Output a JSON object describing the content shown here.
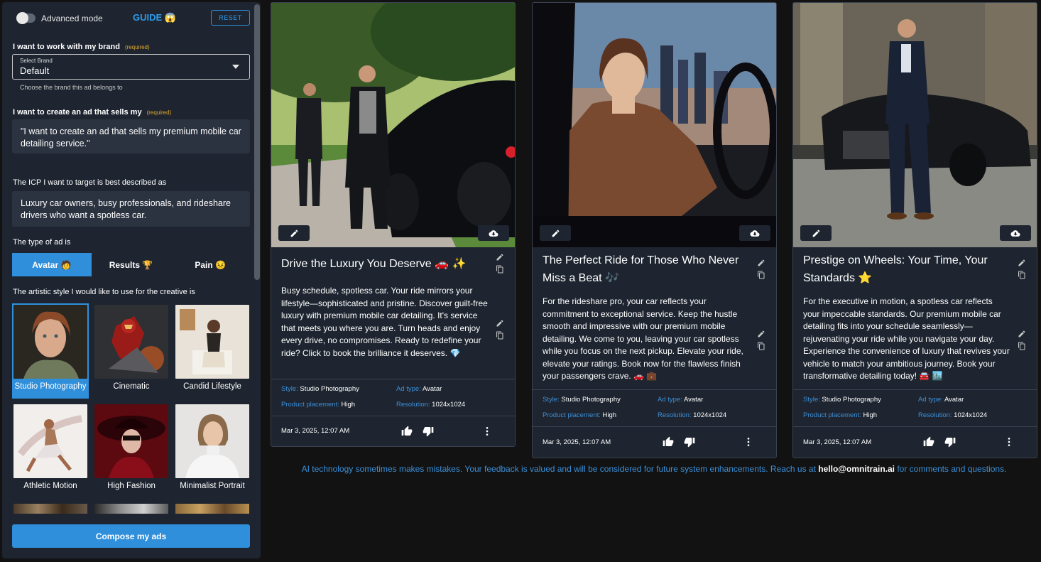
{
  "header": {
    "advanced_mode": "Advanced mode",
    "guide": "GUIDE",
    "guide_emoji": "😱",
    "reset": "RESET"
  },
  "brand": {
    "label": "I want to work with my brand",
    "required": "(required)",
    "select_legend": "Select Brand",
    "value": "Default",
    "helper": "Choose the brand this ad belongs to"
  },
  "product": {
    "label": "I want to create an ad that sells my",
    "required": "(required)",
    "value": "\"I want to create an ad that sells my premium mobile car detailing service.\""
  },
  "icp": {
    "label": "The ICP I want to target is best described as",
    "value": "Luxury car owners, busy professionals, and rideshare drivers who want a spotless car."
  },
  "ad_type": {
    "label": "The type of ad is",
    "tabs": [
      "Avatar 🧑",
      "Results 🏆",
      "Pain 😣"
    ],
    "active": 0
  },
  "style": {
    "label": "The artistic style I would like to use for the creative is",
    "options": [
      "Studio Photography",
      "Cinematic",
      "Candid Lifestyle",
      "Athletic Motion",
      "High Fashion",
      "Minimalist Portrait"
    ],
    "selected": 0
  },
  "compose_label": "Compose my ads",
  "meta_keys": {
    "style": "Style:",
    "ad_type": "Ad type:",
    "placement": "Product placement:",
    "resolution": "Resolution:"
  },
  "cards": [
    {
      "title": "Drive the Luxury You Deserve 🚗 ✨",
      "body": "Busy schedule, spotless car. Your ride mirrors your lifestyle—sophisticated and pristine. Discover guilt-free luxury with premium mobile car detailing. It's service that meets you where you are. Turn heads and enjoy every drive, no compromises. Ready to redefine your ride? Click to book the brilliance it deserves. 💎",
      "style": "Studio Photography",
      "ad_type": "Avatar",
      "placement": "High",
      "resolution": "1024x1024",
      "date": "Mar 3, 2025, 12:07 AM"
    },
    {
      "title": "The Perfect Ride for Those Who Never Miss a Beat 🎶",
      "body": "For the rideshare pro, your car reflects your commitment to exceptional service. Keep the hustle smooth and impressive with our premium mobile detailing. We come to you, leaving your car spotless while you focus on the next pickup. Elevate your ride, elevate your ratings. Book now for the flawless finish your passengers crave. 🚗 💼",
      "style": "Studio Photography",
      "ad_type": "Avatar",
      "placement": "High",
      "resolution": "1024x1024",
      "date": "Mar 3, 2025, 12:07 AM"
    },
    {
      "title": "Prestige on Wheels: Your Time, Your Standards ⭐",
      "body": "For the executive in motion, a spotless car reflects your impeccable standards. Our premium mobile car detailing fits into your schedule seamlessly—rejuvenating your ride while you navigate your day. Experience the convenience of luxury that revives your vehicle to match your ambitious journey. Book your transformative detailing today! 🚘 🏙️",
      "style": "Studio Photography",
      "ad_type": "Avatar",
      "placement": "High",
      "resolution": "1024x1024",
      "date": "Mar 3, 2025, 12:07 AM"
    }
  ],
  "notice": {
    "before": "AI technology sometimes makes mistakes. Your feedback is valued and will be considered for future system enhancements. Reach us at ",
    "email": "hello@omnitrain.ai",
    "after": " for comments and questions."
  },
  "colors": {
    "accent": "#2f8fdb",
    "panel": "#1e2530",
    "input": "#2b3340",
    "required": "#e2a82c",
    "background": "#121212"
  }
}
